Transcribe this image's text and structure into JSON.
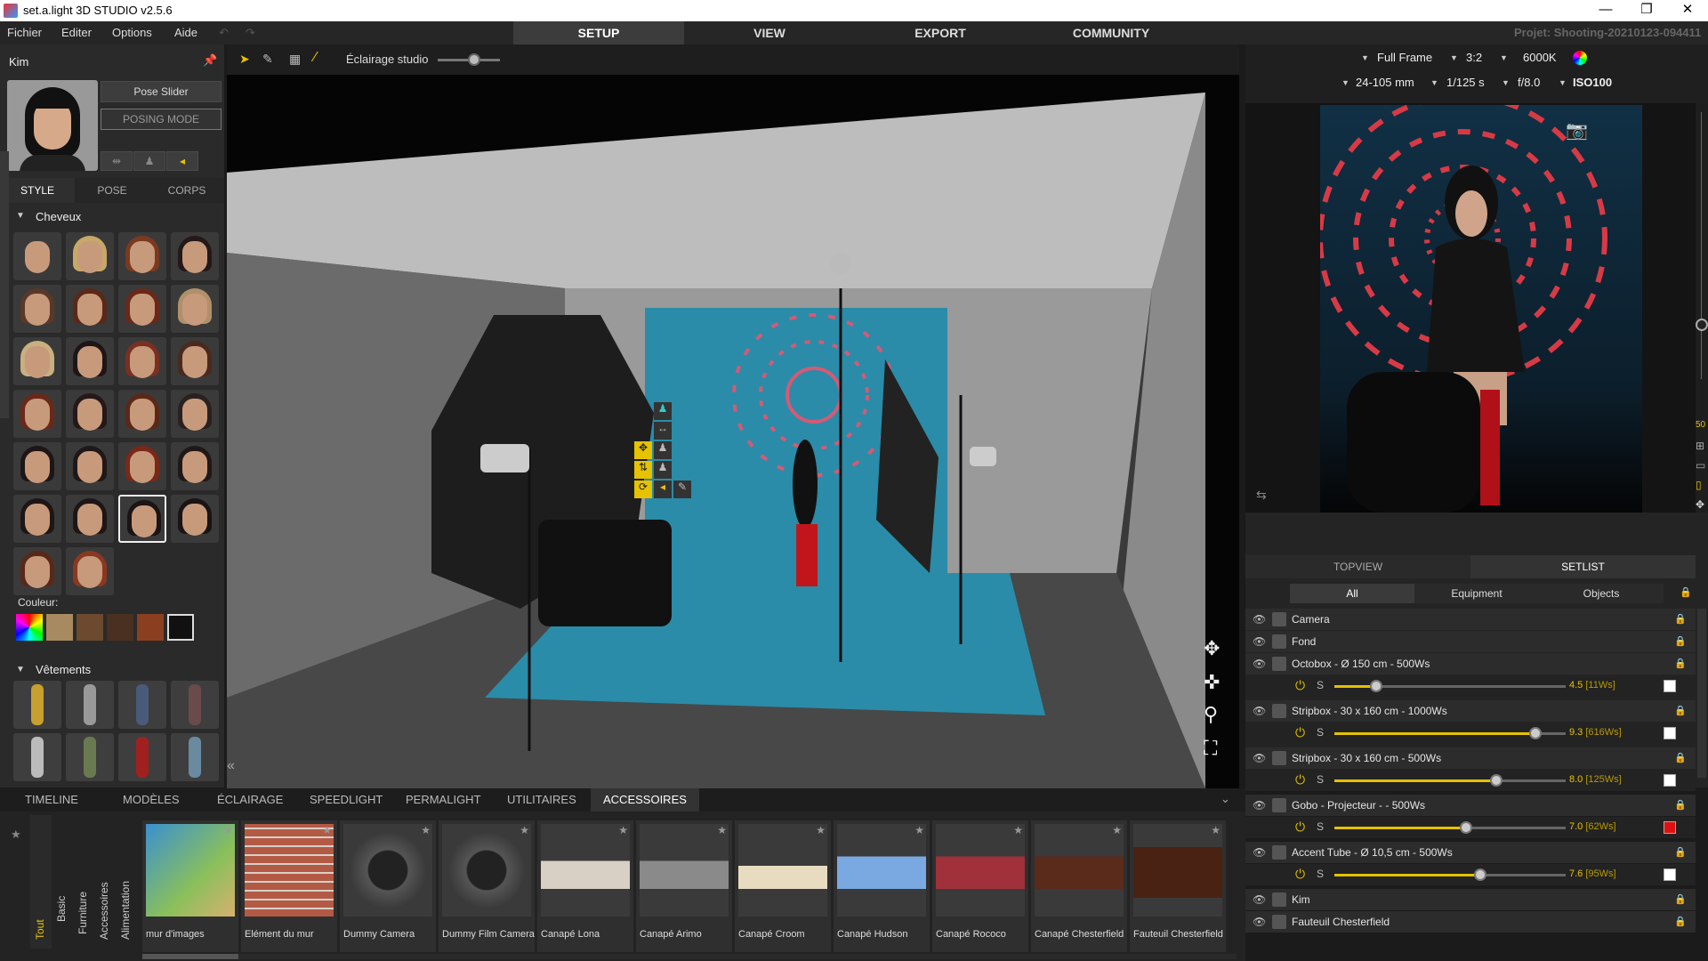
{
  "window": {
    "title": "set.a.light 3D STUDIO v2.5.6",
    "minimize": "—",
    "maximize": "❐",
    "close": "✕"
  },
  "menu": {
    "items": [
      "Fichier",
      "Editer",
      "Options",
      "Aide"
    ]
  },
  "main_tabs": [
    "SETUP",
    "VIEW",
    "EXPORT",
    "COMMUNITY"
  ],
  "project": "Projet: Shooting-20210123-094411",
  "model": {
    "name": "Kim",
    "pose_slider": "Pose Slider",
    "posing_mode": "POSING MODE",
    "tabs": [
      "STYLE",
      "POSE",
      "CORPS"
    ],
    "hair_section": "Cheveux",
    "color_label": "Couleur:",
    "clothes_section": "Vêtements"
  },
  "viewport_toolbar": {
    "lighting_label": "Éclairage studio"
  },
  "camera": {
    "sensor": "Full Frame",
    "ratio": "3:2",
    "kelvin": "6000K",
    "lens": "24-105 mm",
    "shutter": "1/125 s",
    "aperture": "f/8.0",
    "iso": "ISO100"
  },
  "preview": {
    "zoom_value": "50"
  },
  "right_tabs": [
    "TOPVIEW",
    "SETLIST"
  ],
  "filter_tabs": [
    "All",
    "Equipment",
    "Objects"
  ],
  "setlist": [
    {
      "name": "Camera",
      "icon": "camera-icon"
    },
    {
      "name": "Fond",
      "icon": "backdrop-icon"
    },
    {
      "name": "Octobox - Ø 150 cm - 500Ws",
      "icon": "octobox-icon",
      "power_label": "S",
      "value": "4.5",
      "ws": "[11Ws]",
      "level": 0.18,
      "color": "#ffffff"
    },
    {
      "name": "Stripbox - 30 x 160 cm - 1000Ws",
      "icon": "stripbox-icon",
      "power_label": "S",
      "value": "9.3",
      "ws": "[616Ws]",
      "level": 0.87,
      "color": "#ffffff"
    },
    {
      "name": "Stripbox - 30 x 160 cm - 500Ws",
      "icon": "stripbox-icon",
      "power_label": "S",
      "value": "8.0",
      "ws": "[125Ws]",
      "level": 0.7,
      "color": "#ffffff"
    },
    {
      "name": "Gobo - Projecteur - - 500Ws",
      "icon": "gobo-icon",
      "power_label": "S",
      "value": "7.0",
      "ws": "[62Ws]",
      "level": 0.57,
      "color": "#e01010"
    },
    {
      "name": "Accent Tube - Ø 10,5 cm - 500Ws",
      "icon": "tube-icon",
      "power_label": "S",
      "value": "7.6",
      "ws": "[95Ws]",
      "level": 0.63,
      "color": "#ffffff"
    },
    {
      "name": "Kim",
      "icon": "person-icon"
    },
    {
      "name": "Fauteuil Chesterfield",
      "icon": "chair-icon"
    }
  ],
  "bottom_tabs": [
    "TIMELINE",
    "MODÈLES",
    "ÉCLAIRAGE",
    "SPEEDLIGHT",
    "PERMALIGHT",
    "UTILITAIRES",
    "ACCESSOIRES"
  ],
  "side_tabs": [
    "Tout",
    "Basic",
    "Furniture",
    "Accessoires",
    "Alimentation"
  ],
  "accessories": [
    "mur d'images",
    "Elément du mur",
    "Dummy Camera",
    "Dummy Film Camera",
    "Canapé Lona",
    "Canapé Arimo",
    "Canapé Croom",
    "Canapé Hudson",
    "Canapé Rococo",
    "Canapé Chesterfield",
    "Fauteuil Chesterfield"
  ],
  "colors": {
    "accent": "#e6c200",
    "backdrop": "#2a8ca8",
    "gobo_red": "#e01010"
  }
}
